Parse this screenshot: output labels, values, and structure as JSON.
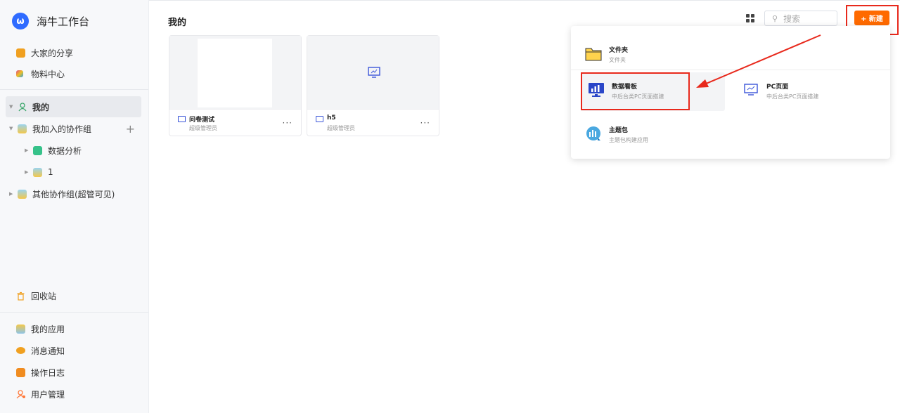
{
  "app": {
    "logo_glyph": "ω",
    "title": "海牛工作台"
  },
  "sidebar": {
    "top_items": [
      {
        "label": "大家的分享",
        "icon": "briefcase-icon",
        "color": "#f0a020"
      },
      {
        "label": "物料中心",
        "icon": "cube-icon",
        "color": "#e04a8a"
      }
    ],
    "tree": [
      {
        "label": "我的",
        "icon": "user-icon",
        "expanded": true,
        "active": true
      },
      {
        "label": "我加入的协作组",
        "icon": "group-icon",
        "expanded": true,
        "action": "+"
      },
      {
        "label": "数据分析",
        "icon": "chart-icon",
        "expanded": false
      },
      {
        "label": "1",
        "icon": "group-icon",
        "expanded": false
      },
      {
        "label": "其他协作组(超管可见)",
        "icon": "group-icon",
        "expanded": false
      }
    ],
    "trash": {
      "label": "回收站",
      "icon": "trash-icon"
    },
    "bottom_items": [
      {
        "label": "我的应用",
        "icon": "apps-icon",
        "color": "#e0a020"
      },
      {
        "label": "消息通知",
        "icon": "message-icon",
        "color": "#f0a020"
      },
      {
        "label": "操作日志",
        "icon": "log-icon",
        "color": "#f08020"
      },
      {
        "label": "用户管理",
        "icon": "user-manage-icon",
        "color": "#ff7a3c"
      }
    ]
  },
  "main": {
    "title": "我的",
    "search_placeholder": "搜索",
    "new_button": "+ 新建",
    "cards": [
      {
        "name": "问卷测试",
        "owner": "超级管理员",
        "more": "···"
      },
      {
        "name": "h5",
        "owner": "超级管理员",
        "more": "···"
      }
    ]
  },
  "dropdown": {
    "options": [
      {
        "name": "文件夹",
        "desc": "文件夹",
        "icon": "folder-icon"
      },
      {
        "name": "数据看板",
        "desc": "中后台类PC页面搭建",
        "icon": "dashboard-icon"
      },
      {
        "name": "PC页面",
        "desc": "中后台类PC页面搭建",
        "icon": "pc-page-icon"
      },
      {
        "name": "主题包",
        "desc": "主题包构建应用",
        "icon": "theme-icon"
      }
    ]
  },
  "colors": {
    "accent": "#ff6a00",
    "annotation": "#e8291c",
    "brand": "#2f6bff"
  }
}
